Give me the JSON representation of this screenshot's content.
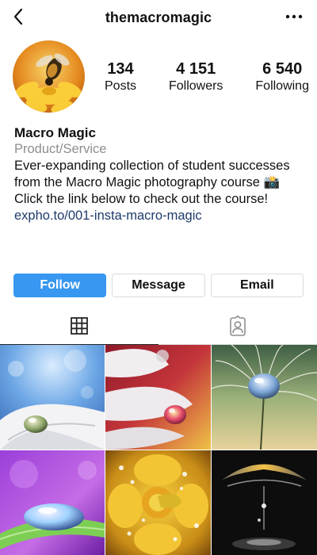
{
  "header": {
    "username": "themacromagic",
    "back_icon": "chevron-left-icon",
    "more_icon": "more-horizontal-icon"
  },
  "profile": {
    "stats": [
      {
        "value": "134",
        "label": "Posts"
      },
      {
        "value": "4 151",
        "label": "Followers"
      },
      {
        "value": "6 540",
        "label": "Following"
      }
    ],
    "name": "Macro Magic",
    "category": "Product/Service",
    "bio_line1": "Ever-expanding collection of student successes from the Macro Magic photography course 📸",
    "bio_line2": "Click the link below to check out the course!",
    "link": "expho.to/001-insta-macro-magic"
  },
  "actions": {
    "follow_label": "Follow",
    "message_label": "Message",
    "email_label": "Email"
  },
  "tabs": [
    {
      "icon": "grid-icon",
      "active": true
    },
    {
      "icon": "tagged-user-icon",
      "active": false
    }
  ],
  "colors": {
    "accent": "#3897f0",
    "link": "#1d3b6b",
    "muted": "#8e8e8e",
    "border": "#dbdbdb"
  }
}
